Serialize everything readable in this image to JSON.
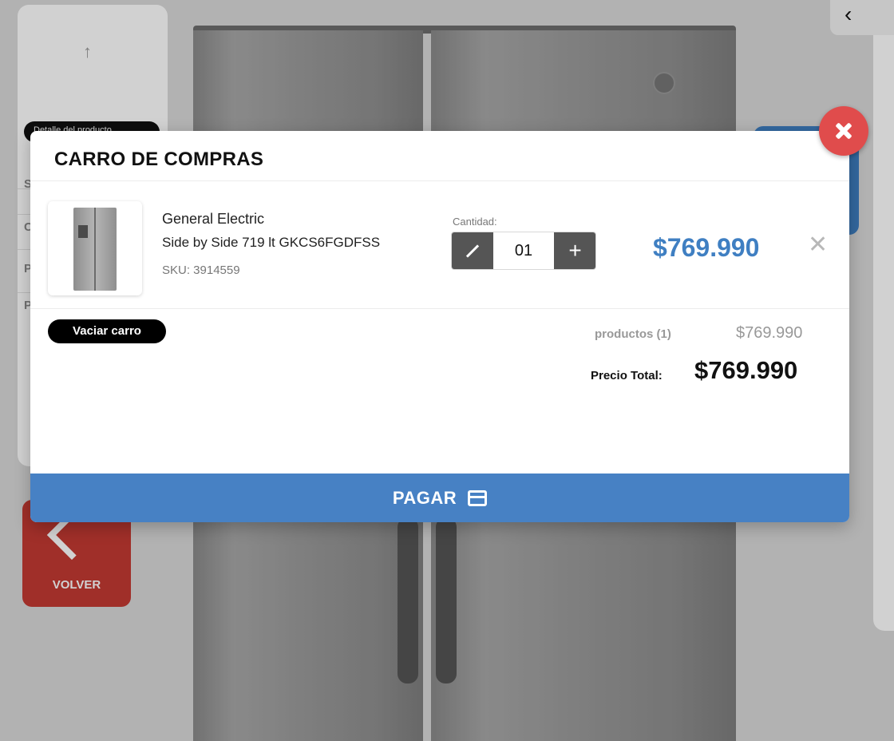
{
  "background": {
    "pill_text": "Detalle del producto",
    "side_letters": [
      "S",
      "C",
      "P",
      "P"
    ],
    "volver_label": "VOLVER"
  },
  "modal": {
    "title": "CARRO DE COMPRAS",
    "item": {
      "brand": "General Electric",
      "model": "Side by Side 719 lt GKCS6FGDFSS",
      "sku": "SKU: 3914559",
      "quantity_label": "Cantidad:",
      "quantity": "01",
      "price": "$769.990"
    },
    "empty_cart_label": "Vaciar carro",
    "summary": {
      "products_label": "productos (1)",
      "products_value": "$769.990",
      "total_label": "Precio Total:",
      "total_value": "$769.990"
    },
    "pay_label": "PAGAR"
  },
  "colors": {
    "accent": "#4781c4",
    "close": "#e04c4c",
    "volver": "#c43a33"
  }
}
